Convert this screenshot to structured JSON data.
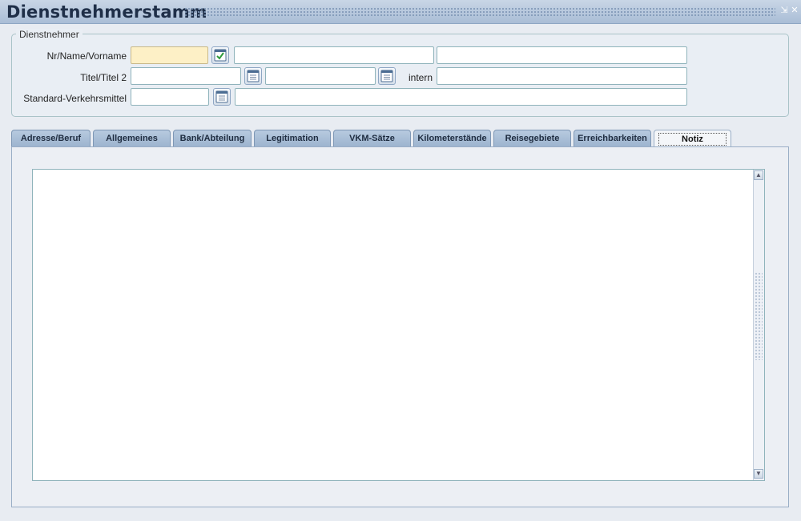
{
  "window": {
    "title": "Dienstnehmerstamm",
    "minimize_icon": "minimize-icon",
    "close_icon": "close-icon"
  },
  "group": {
    "legend": "Dienstnehmer",
    "rows": [
      {
        "label": "Nr/Name/Vorname"
      },
      {
        "label": "Titel/Titel 2",
        "extra_label": "intern"
      },
      {
        "label": "Standard-Verkehrsmittel"
      }
    ],
    "fields": {
      "nr": "",
      "name": "",
      "vorname": "",
      "titel": "",
      "titel2": "",
      "intern": "",
      "verkehrsmittel_code": "",
      "verkehrsmittel_text": ""
    }
  },
  "tabs": [
    {
      "label": "Adresse/Beruf"
    },
    {
      "label": "Allgemeines"
    },
    {
      "label": "Bank/Abteilung"
    },
    {
      "label": "Legitimation"
    },
    {
      "label": "VKM-Sätze"
    },
    {
      "label": "Kilometerstände"
    },
    {
      "label": "Reisegebiete"
    },
    {
      "label": "Erreichbarkeiten"
    },
    {
      "label": "Notiz",
      "active": true
    }
  ],
  "notiz": {
    "text": ""
  },
  "colors": {
    "highlight_field": "#fdf0c6",
    "tab_inactive": "#9db4cf",
    "title_text": "#1f2f48"
  }
}
